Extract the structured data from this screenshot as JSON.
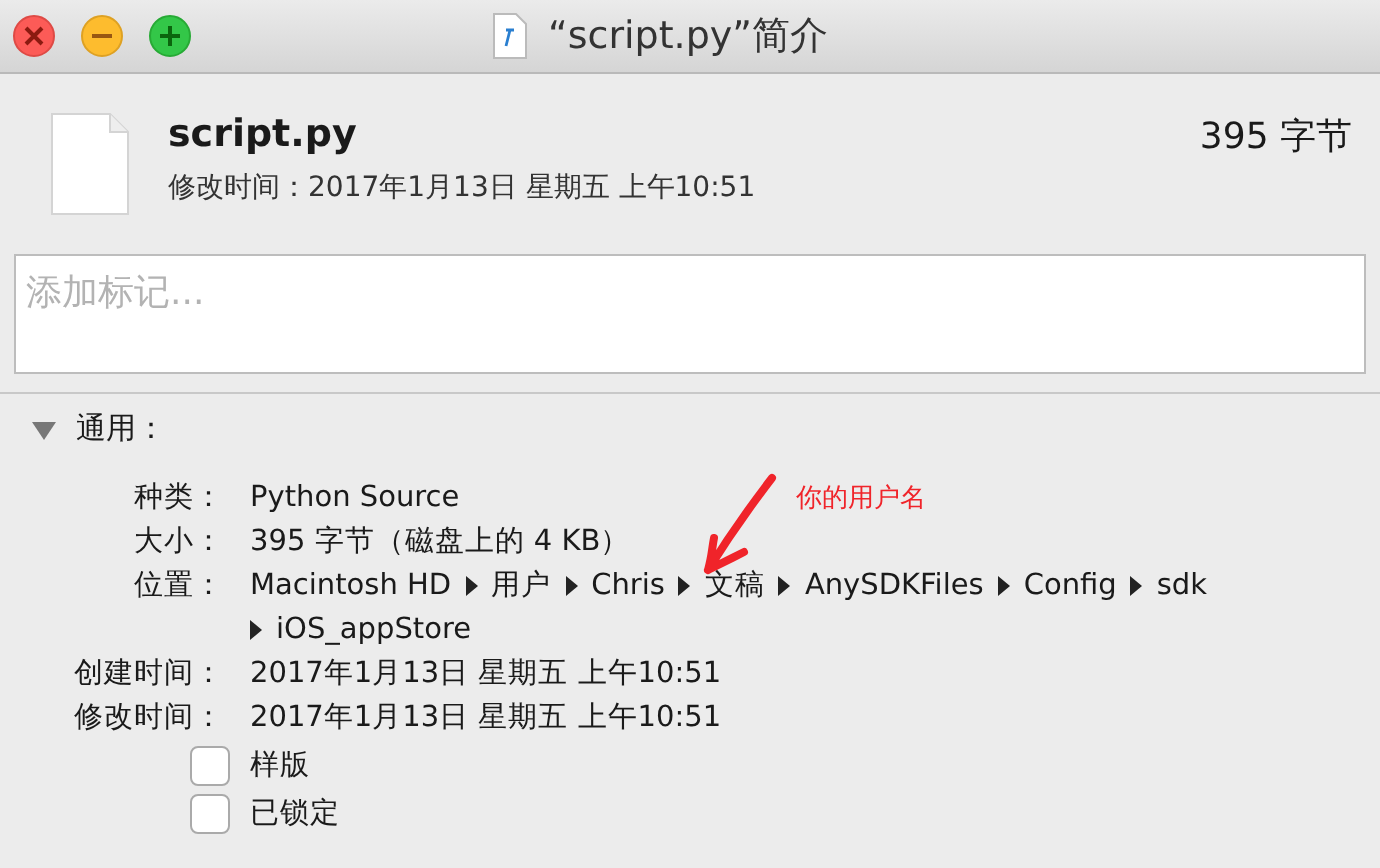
{
  "window": {
    "title": "“script.py”简介"
  },
  "file": {
    "name": "script.py",
    "size": "395 字节",
    "modified": "修改时间：2017年1月13日 星期五 上午10:51"
  },
  "tags_field": {
    "placeholder": "添加标记..."
  },
  "section": {
    "title": "通用：",
    "expanded": true
  },
  "info": [
    {
      "label": "种类：",
      "value": "Python Source"
    },
    {
      "label": "大小：",
      "value": "395 字节（磁盘上的 4 KB）"
    },
    {
      "label": "位置：",
      "path": [
        "Macintosh HD",
        "用户",
        "Chris",
        "文稿",
        "AnySDKFiles",
        "Config",
        "sdk",
        "iOS_appStore"
      ]
    },
    {
      "label": "创建时间：",
      "value": "2017年1月13日 星期五 上午10:51"
    },
    {
      "label": "修改时间：",
      "value": "2017年1月13日 星期五 上午10:51"
    }
  ],
  "checkboxes": [
    {
      "label": "样版",
      "checked": false
    },
    {
      "label": "已锁定",
      "checked": false
    }
  ],
  "annotation": {
    "text": "你的用户名"
  }
}
